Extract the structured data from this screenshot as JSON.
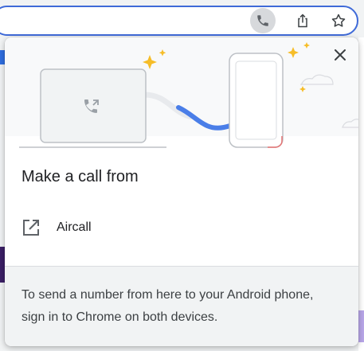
{
  "toolbar": {
    "icons": [
      "phone-icon",
      "share-icon",
      "star-icon"
    ]
  },
  "popup": {
    "title": "Make a call from",
    "devices": [
      {
        "label": "Aircall",
        "icon": "open-external-icon"
      }
    ],
    "footer_text": "To send a number from here to your Android phone, sign in to Chrome on both devices."
  },
  "colors": {
    "accent_blue": "#4a7ee8",
    "sparkle_yellow": "#f6bd28",
    "omnibox_border": "#3f6ad8",
    "footer_bg": "#f1f3f4"
  }
}
